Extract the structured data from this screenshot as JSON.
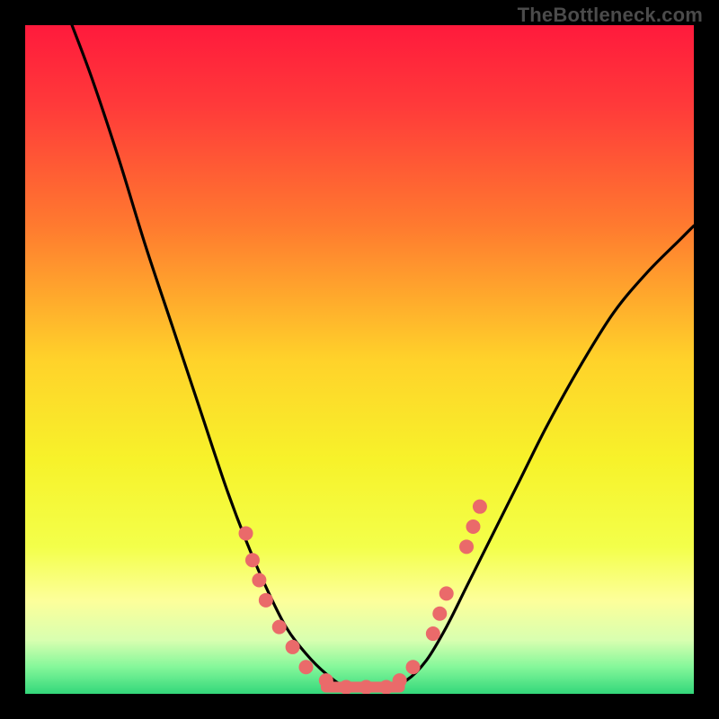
{
  "credit": "TheBottleneck.com",
  "chart_data": {
    "type": "line",
    "title": "",
    "xlabel": "",
    "ylabel": "",
    "xlim": [
      0,
      100
    ],
    "ylim": [
      0,
      100
    ],
    "grid": false,
    "legend": false,
    "background": {
      "type": "vertical-gradient",
      "stops": [
        {
          "pos": 0.0,
          "color": "#ff1a3c"
        },
        {
          "pos": 0.12,
          "color": "#ff3a3a"
        },
        {
          "pos": 0.3,
          "color": "#ff7a2f"
        },
        {
          "pos": 0.5,
          "color": "#ffd22a"
        },
        {
          "pos": 0.65,
          "color": "#f7f22a"
        },
        {
          "pos": 0.78,
          "color": "#f3ff4a"
        },
        {
          "pos": 0.86,
          "color": "#fdff9a"
        },
        {
          "pos": 0.92,
          "color": "#d8ffb0"
        },
        {
          "pos": 0.96,
          "color": "#84f79a"
        },
        {
          "pos": 1.0,
          "color": "#33d77a"
        }
      ]
    },
    "series": [
      {
        "name": "bottleneck-curve",
        "color": "#000000",
        "x": [
          7,
          10,
          14,
          18,
          22,
          26,
          30,
          33,
          36,
          39,
          42,
          45,
          48,
          51,
          54,
          57,
          60,
          63,
          66,
          70,
          74,
          78,
          83,
          88,
          93,
          98,
          100
        ],
        "y": [
          100,
          92,
          80,
          67,
          55,
          43,
          31,
          23,
          16,
          10,
          6,
          3,
          1,
          1,
          1,
          2,
          5,
          10,
          16,
          24,
          32,
          40,
          49,
          57,
          63,
          68,
          70
        ]
      }
    ],
    "markers": [
      {
        "name": "marker",
        "color": "#ea6a6a",
        "x": 33,
        "y": 24
      },
      {
        "name": "marker",
        "color": "#ea6a6a",
        "x": 34,
        "y": 20
      },
      {
        "name": "marker",
        "color": "#ea6a6a",
        "x": 35,
        "y": 17
      },
      {
        "name": "marker",
        "color": "#ea6a6a",
        "x": 36,
        "y": 14
      },
      {
        "name": "marker",
        "color": "#ea6a6a",
        "x": 38,
        "y": 10
      },
      {
        "name": "marker",
        "color": "#ea6a6a",
        "x": 40,
        "y": 7
      },
      {
        "name": "marker",
        "color": "#ea6a6a",
        "x": 42,
        "y": 4
      },
      {
        "name": "marker",
        "color": "#ea6a6a",
        "x": 45,
        "y": 2
      },
      {
        "name": "marker",
        "color": "#ea6a6a",
        "x": 48,
        "y": 1
      },
      {
        "name": "marker",
        "color": "#ea6a6a",
        "x": 51,
        "y": 1
      },
      {
        "name": "marker",
        "color": "#ea6a6a",
        "x": 54,
        "y": 1
      },
      {
        "name": "marker",
        "color": "#ea6a6a",
        "x": 56,
        "y": 2
      },
      {
        "name": "marker",
        "color": "#ea6a6a",
        "x": 58,
        "y": 4
      },
      {
        "name": "marker",
        "color": "#ea6a6a",
        "x": 61,
        "y": 9
      },
      {
        "name": "marker",
        "color": "#ea6a6a",
        "x": 62,
        "y": 12
      },
      {
        "name": "marker",
        "color": "#ea6a6a",
        "x": 63,
        "y": 15
      },
      {
        "name": "marker",
        "color": "#ea6a6a",
        "x": 66,
        "y": 22
      },
      {
        "name": "marker",
        "color": "#ea6a6a",
        "x": 67,
        "y": 25
      },
      {
        "name": "marker",
        "color": "#ea6a6a",
        "x": 68,
        "y": 28
      }
    ],
    "flat_segment": {
      "color": "#ea6a6a",
      "x_start": 45,
      "x_end": 56,
      "y": 1
    }
  }
}
